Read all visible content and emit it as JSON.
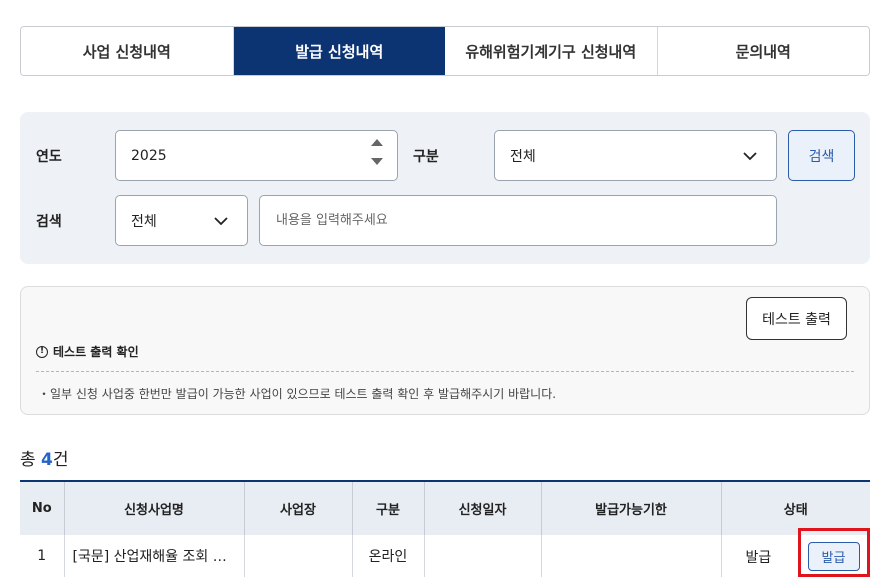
{
  "tabs": [
    {
      "label": "사업 신청내역",
      "active": false
    },
    {
      "label": "발급 신청내역",
      "active": true
    },
    {
      "label": "유해위험기계기구 신청내역",
      "active": false
    },
    {
      "label": "문의내역",
      "active": false
    }
  ],
  "search": {
    "year_label": "연도",
    "year_value": "2025",
    "category_label": "구분",
    "category_value": "전체",
    "search_label": "검색",
    "search_type_value": "전체",
    "keyword_placeholder": "내용을 입력해주세요",
    "search_button": "검색"
  },
  "notice": {
    "test_button": "테스트 출력",
    "title": "테스트 출력 확인",
    "info_glyph": "!",
    "text": "・일부 신청 사업중 한번만 발급이 가능한 사업이 있으므로 테스트 출력 확인 후 발급해주시기 바랍니다."
  },
  "total": {
    "prefix": "총 ",
    "count": "4",
    "suffix": "건"
  },
  "table": {
    "headers": [
      "No",
      "신청사업명",
      "사업장",
      "구분",
      "신청일자",
      "발급가능기한",
      "상태"
    ],
    "rows": [
      {
        "no": "1",
        "name": "[국문] 산업재해율 조회 …",
        "site": "",
        "type": "온라인",
        "date": "",
        "deadline": "",
        "status": "발급",
        "action": "발급"
      }
    ]
  },
  "colors": {
    "primary_navy": "#0c3472",
    "accent_blue": "#2a5caa",
    "highlight_red": "#e0141c"
  },
  "icons": {
    "spinner": "number-spinner-icon",
    "dropdown": "chevron-down-icon",
    "info": "info-circle-icon"
  }
}
